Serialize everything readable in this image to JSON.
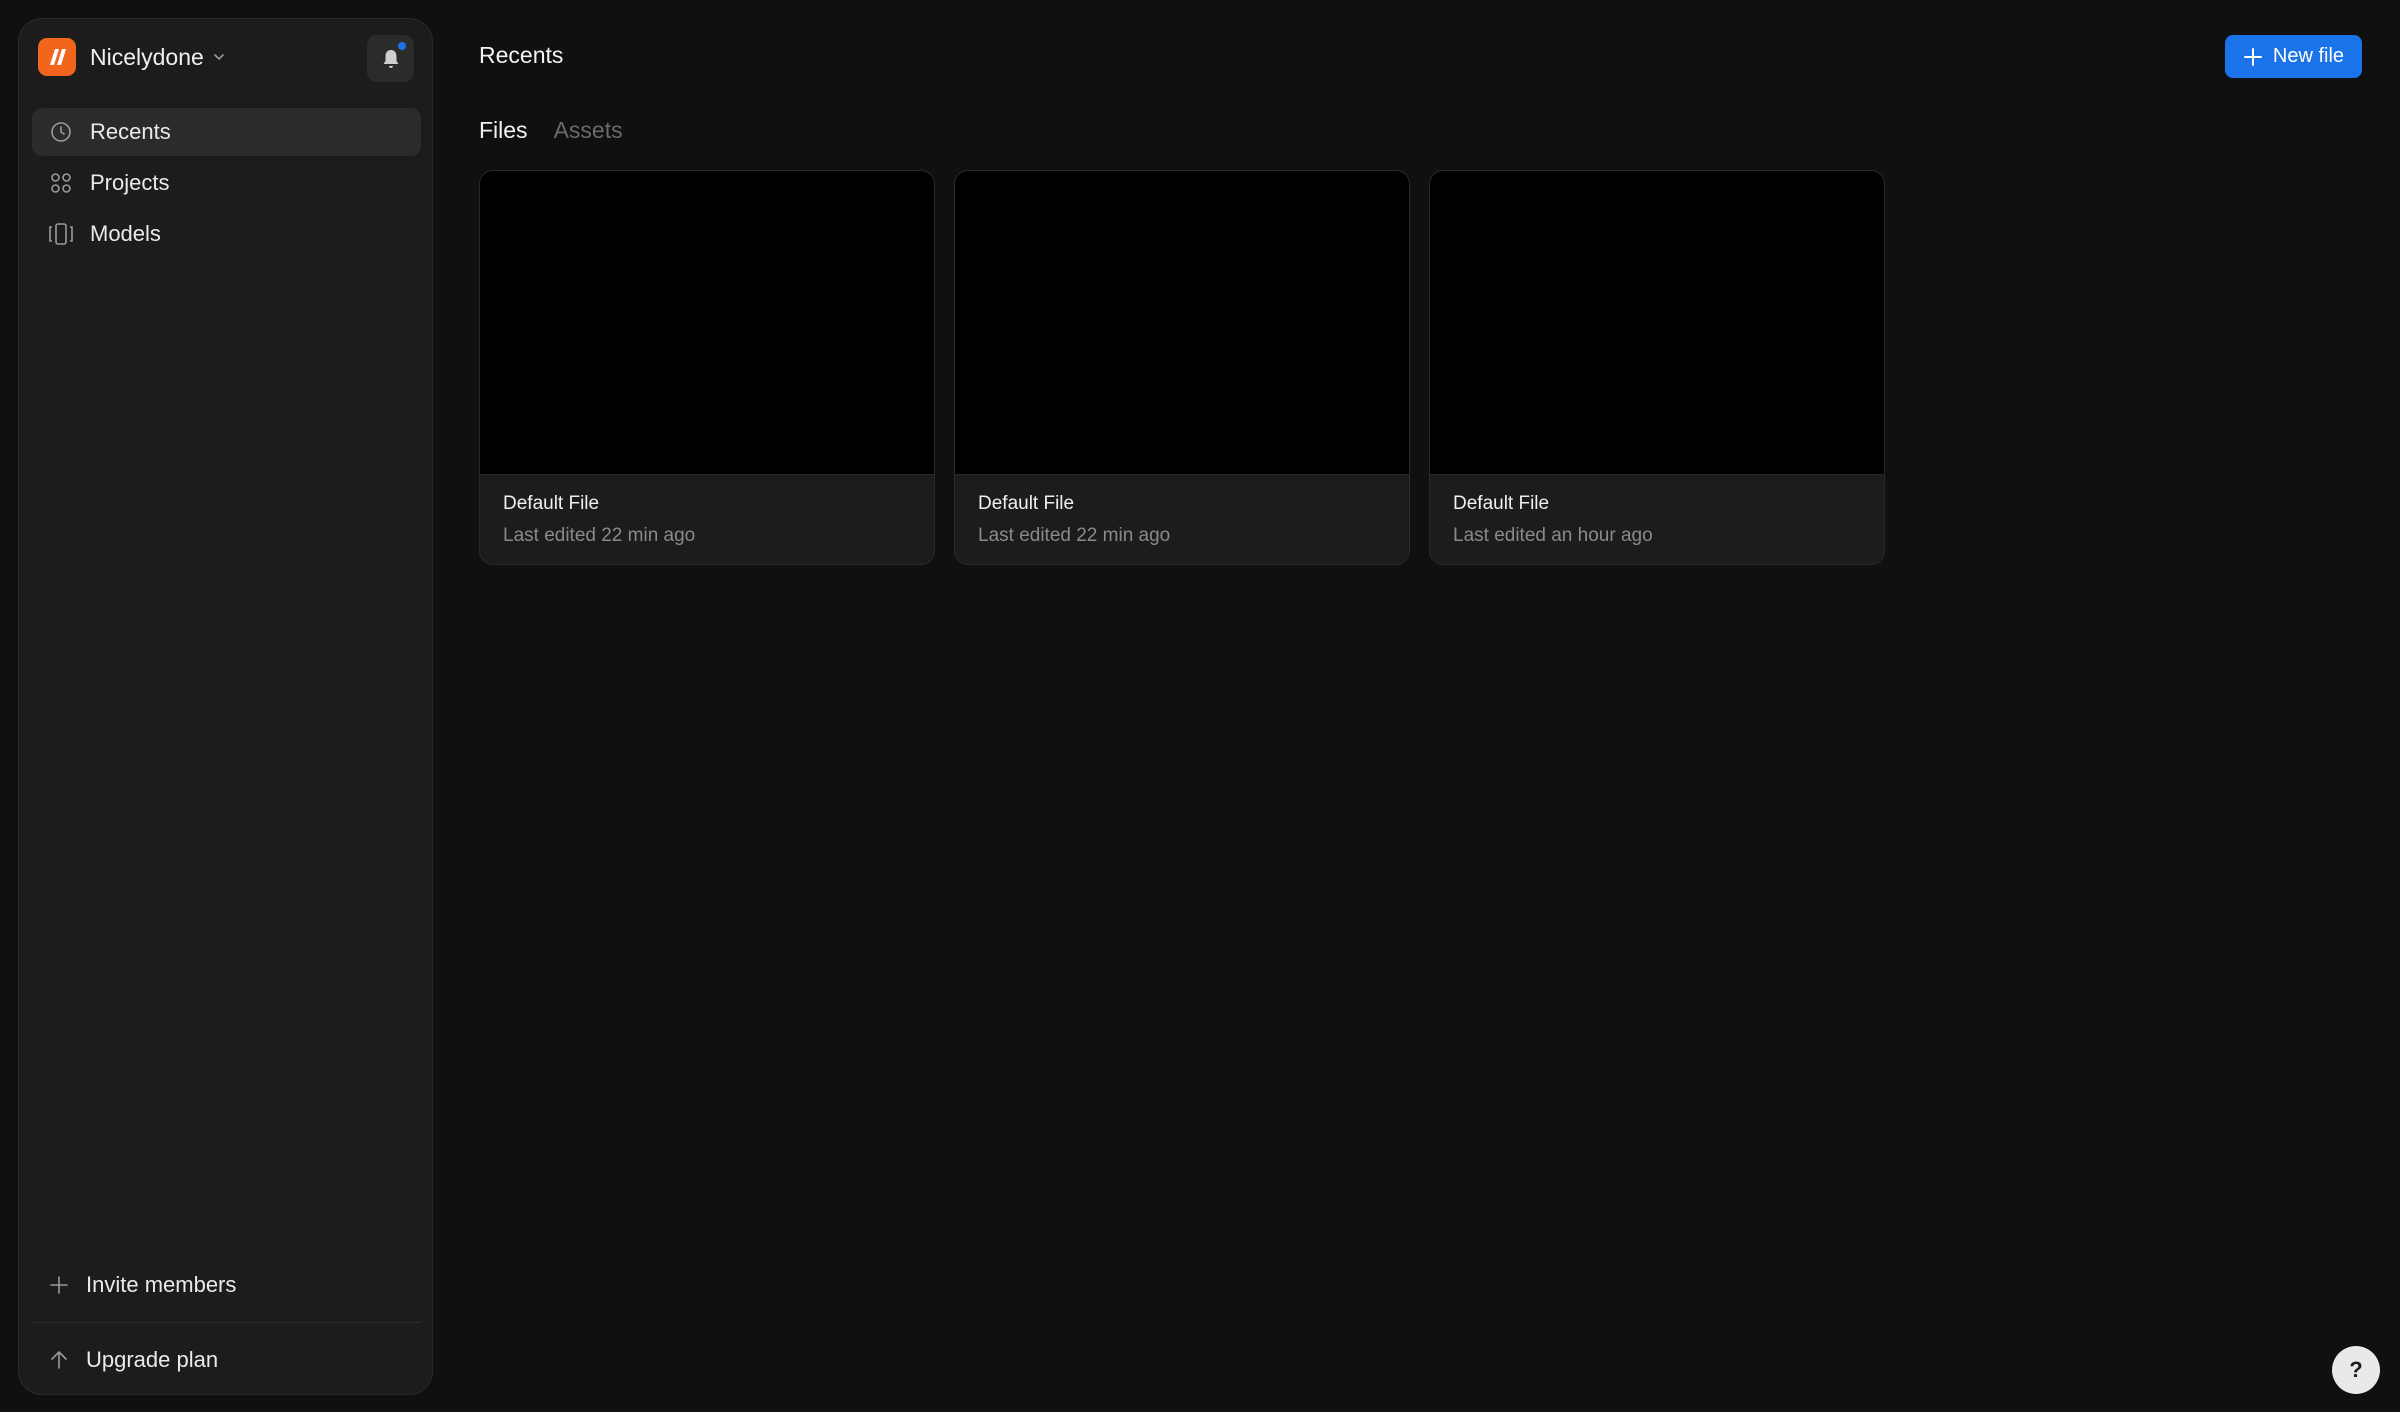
{
  "workspace": {
    "name": "Nicelydone"
  },
  "sidebar": {
    "items": [
      {
        "label": "Recents",
        "icon": "clock-icon",
        "active": true
      },
      {
        "label": "Projects",
        "icon": "grid-icon",
        "active": false
      },
      {
        "label": "Models",
        "icon": "models-icon",
        "active": false
      }
    ],
    "invite_label": "Invite members",
    "upgrade_label": "Upgrade plan"
  },
  "header": {
    "title": "Recents",
    "new_file_label": "New file"
  },
  "tabs": [
    {
      "label": "Files",
      "active": true
    },
    {
      "label": "Assets",
      "active": false
    }
  ],
  "files": [
    {
      "title": "Default File",
      "subtitle": "Last edited 22 min ago"
    },
    {
      "title": "Default File",
      "subtitle": "Last edited 22 min ago"
    },
    {
      "title": "Default File",
      "subtitle": "Last edited an hour ago"
    }
  ],
  "help": {
    "label": "?"
  },
  "colors": {
    "accent": "#1a73e8",
    "brand": "#f2651d",
    "background": "#101010",
    "sidebar": "#1c1c1c"
  }
}
